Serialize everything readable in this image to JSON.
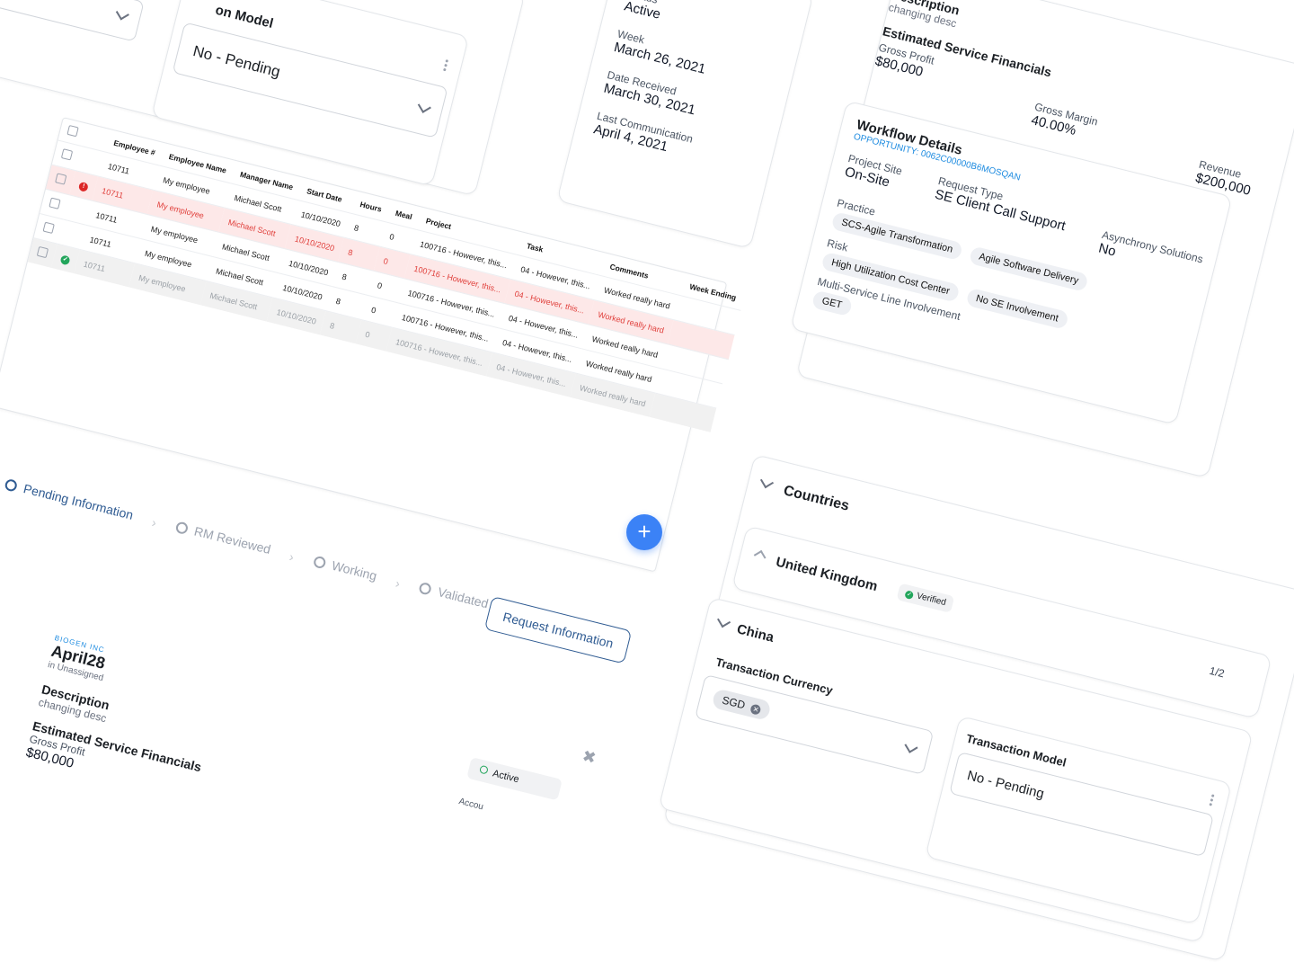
{
  "top_select_card": {
    "title_fragment": "on Model",
    "value": "No - Pending"
  },
  "status_card": {
    "status_label": "Status",
    "status_value": "Active",
    "week_label": "Week",
    "week_value": "March 26, 2021",
    "received_label": "Date Received",
    "received_value": "March 30, 2021",
    "last_comm_label": "Last Communication",
    "last_comm_value": "April 4, 2021"
  },
  "detail_card": {
    "description_label": "Description",
    "description_value": "changing desc",
    "financials_title": "Estimated Service Financials",
    "gross_profit_label": "Gross Profit",
    "gross_profit_value": "$80,000",
    "gross_margin_label": "Gross Margin",
    "gross_margin_value": "40.00%",
    "revenue_label": "Revenue",
    "revenue_value": "$200,000",
    "workflow_title": "Workflow Details",
    "opportunity_link": "OPPORTUNITY: 0062C00000B6MOSQAN",
    "project_site_label": "Project Site",
    "project_site_value": "On-Site",
    "request_type_label": "Request Type",
    "request_type_value": "SE Client Call Support",
    "asynchrony_label": "Asynchrony Solutions",
    "asynchrony_value": "No",
    "practice_label": "Practice",
    "practice_chips": [
      "SCS-Agile Transformation",
      "Agile Software Delivery"
    ],
    "risk_label": "Risk",
    "risk_chips": [
      "High Utilization Cost Center",
      "No SE Involvement"
    ],
    "msl_label": "Multi-Service Line Involvement",
    "msl_chips": [
      "GET"
    ]
  },
  "timesheet": {
    "headers": [
      "Employee #",
      "Employee Name",
      "Manager Name",
      "Start Date",
      "Hours",
      "Meal",
      "Project",
      "Task",
      "Comments",
      "Week Ending"
    ],
    "rows": [
      {
        "state": "normal",
        "emp": "10711",
        "name": "My employee",
        "mgr": "Michael Scott",
        "start": "10/10/2020",
        "hours": "8",
        "meal": "0",
        "project": "100716 - However, this...",
        "task": "04 - However, this...",
        "comments": "Worked really hard",
        "week": ""
      },
      {
        "state": "err",
        "emp": "10711",
        "name": "My employee",
        "mgr": "Michael Scott",
        "start": "10/10/2020",
        "hours": "8",
        "meal": "0",
        "project": "100716 - However, this...",
        "task": "04 - However, this...",
        "comments": "Worked really hard",
        "week": ""
      },
      {
        "state": "normal",
        "emp": "10711",
        "name": "My employee",
        "mgr": "Michael Scott",
        "start": "10/10/2020",
        "hours": "8",
        "meal": "0",
        "project": "100716 - However, this...",
        "task": "04 - However, this...",
        "comments": "Worked really hard",
        "week": ""
      },
      {
        "state": "normal",
        "emp": "10711",
        "name": "My employee",
        "mgr": "Michael Scott",
        "start": "10/10/2020",
        "hours": "8",
        "meal": "0",
        "project": "100716 - However, this...",
        "task": "04 - However, this...",
        "comments": "Worked really hard",
        "week": ""
      },
      {
        "state": "dim",
        "emp": "10711",
        "name": "My employee",
        "mgr": "Michael Scott",
        "start": "10/10/2020",
        "hours": "8",
        "meal": "0",
        "project": "100716 - However, this...",
        "task": "04 - However, this...",
        "comments": "Worked really hard",
        "week": ""
      }
    ],
    "fab_label": "+"
  },
  "stepper": {
    "steps": [
      "Pending Information",
      "RM Reviewed",
      "Working",
      "Validated"
    ],
    "request_button": "Request Information"
  },
  "bottom_card": {
    "company": "BIOGEN INC",
    "title": "April28",
    "subtitle": "in Unassigned",
    "description_label": "Description",
    "description_value": "changing desc",
    "financials_title": "Estimated Service Financials",
    "gross_profit_label": "Gross Profit",
    "gross_profit_value": "$80,000",
    "status_chip": "Active",
    "acct_fragment": "Accou"
  },
  "countries_card": {
    "title": "Countries",
    "country1": "United Kingdom",
    "verified_badge": "Verified",
    "pager": "1/2",
    "country2": "China",
    "currency_label": "Transaction Currency",
    "currency_chip": "SGD",
    "model_label": "Transaction Model",
    "model_value": "No - Pending"
  }
}
